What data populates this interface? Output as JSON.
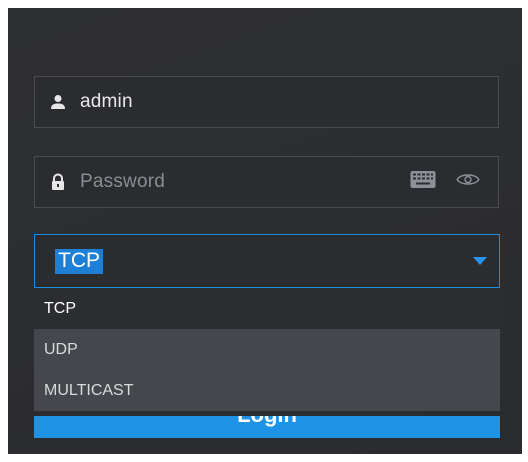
{
  "login_form": {
    "username": {
      "value": "admin",
      "icon": "user-icon"
    },
    "password": {
      "placeholder": "Password",
      "icon": "lock-icon",
      "keyboard_icon": "keyboard-icon",
      "visibility_icon": "eye-icon"
    },
    "protocol": {
      "selected": "TCP",
      "options": [
        "TCP",
        "UDP",
        "MULTICAST"
      ]
    },
    "login_button": {
      "label": "Login"
    }
  },
  "colors": {
    "panel_background": "#2e2f33",
    "accent": "#1e93e6",
    "dropdown_background": "#45474c",
    "selected_option_background": "#2c2d31"
  }
}
